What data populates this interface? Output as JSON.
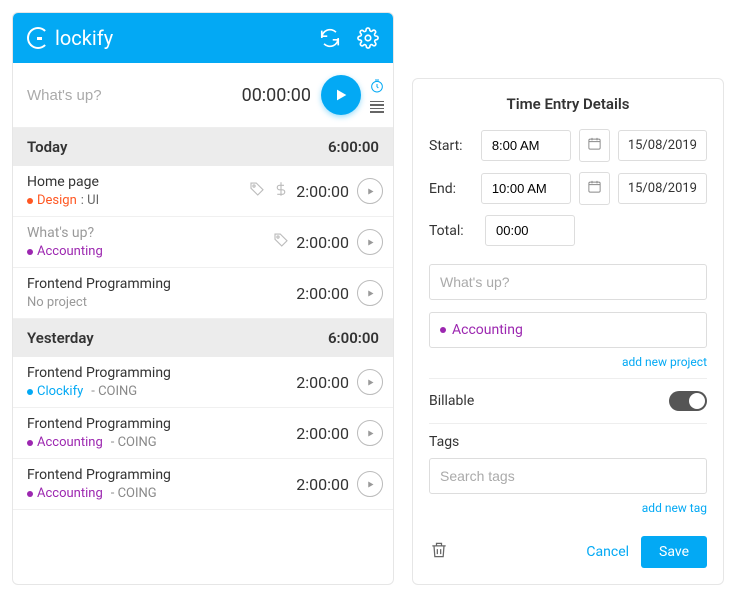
{
  "brand": "lockify",
  "timer": {
    "placeholder": "What's up?",
    "time": "00:00:00"
  },
  "sections": [
    {
      "label": "Today",
      "total": "6:00:00",
      "entries": [
        {
          "title": "Home page",
          "projectColor": "orange",
          "projectName": "Design",
          "taskName": ": UI",
          "clientName": "",
          "showTag": true,
          "showBill": true,
          "duration": "2:00:00"
        },
        {
          "title": "What's up?",
          "muted": true,
          "projectColor": "purple",
          "projectName": "Accounting",
          "taskName": "",
          "clientName": "",
          "showTag": true,
          "showBill": false,
          "duration": "2:00:00"
        },
        {
          "title": "Frontend Programming",
          "projectColor": "grey",
          "projectName": "No project",
          "taskName": "",
          "clientName": "",
          "showTag": false,
          "showBill": false,
          "duration": "2:00:00"
        }
      ]
    },
    {
      "label": "Yesterday",
      "total": "6:00:00",
      "entries": [
        {
          "title": "Frontend Programming",
          "projectColor": "blue",
          "projectName": "Clockify",
          "taskName": "",
          "clientName": " - COING",
          "showTag": false,
          "showBill": false,
          "duration": "2:00:00"
        },
        {
          "title": "Frontend Programming",
          "projectColor": "purple",
          "projectName": "Accounting",
          "taskName": "",
          "clientName": " - COING",
          "showTag": false,
          "showBill": false,
          "duration": "2:00:00"
        },
        {
          "title": "Frontend Programming",
          "projectColor": "purple",
          "projectName": "Accounting",
          "taskName": "",
          "clientName": " - COING",
          "showTag": false,
          "showBill": false,
          "duration": "2:00:00"
        }
      ]
    }
  ],
  "details": {
    "heading": "Time Entry Details",
    "startLabel": "Start:",
    "startTime": "8:00 AM",
    "startDate": "15/08/2019",
    "endLabel": "End:",
    "endTime": "10:00 AM",
    "endDate": "15/08/2019",
    "totalLabel": "Total:",
    "totalValue": "00:00",
    "descPlaceholder": "What's up?",
    "projectName": "Accounting",
    "addProject": "add new project",
    "billableLabel": "Billable",
    "tagsLabel": "Tags",
    "tagsPlaceholder": "Search tags",
    "addTag": "add new tag",
    "cancel": "Cancel",
    "save": "Save"
  }
}
